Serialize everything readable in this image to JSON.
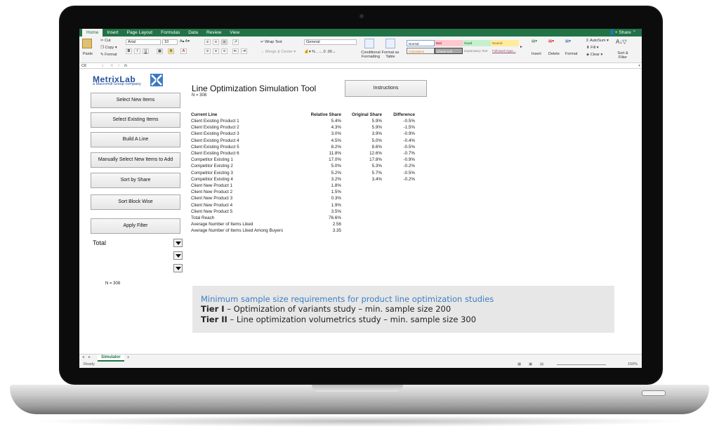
{
  "ribbon": {
    "tabs": [
      "Home",
      "Insert",
      "Page Layout",
      "Formulas",
      "Data",
      "Review",
      "View"
    ],
    "share_label": "Share",
    "paste": "Paste",
    "cut": "Cut",
    "copy": "Copy",
    "format": "Format",
    "font_name": "Arial",
    "font_size": "10",
    "bold": "B",
    "italic": "I",
    "underline": "U",
    "wrap_text": "Wrap Text",
    "merge_center": "Merge & Center",
    "number_format": "General",
    "conditional_formatting": "Conditional Formatting",
    "format_as_table": "Format as Table",
    "styles": [
      "Normal",
      "Bad",
      "Good",
      "Neutral",
      "Calculation",
      "Check Cell",
      "Explanatory Text",
      "Followed Hype..."
    ],
    "insert": "Insert",
    "delete": "Delete",
    "format_cells": "Format",
    "autosum": "AutoSum",
    "fill": "Fill",
    "clear": "Clear",
    "sort_filter": "Sort & Filter"
  },
  "formula_bar": {
    "cell_ref": "C6",
    "fx": "fx"
  },
  "sheet": {
    "logo_text": "MetrixLab",
    "logo_sub": "a Macromill Group company",
    "buttons": {
      "select_new": "Select New Items",
      "select_existing": "Select Existing Items",
      "build_line": "Build A Line",
      "manual_select": "Manually Select New Items to Add",
      "sort_share": "Sort by Share",
      "sort_block": "Sort Block Wise",
      "apply_filter": "Apply Filter",
      "instructions": "Instructions"
    },
    "title": "Line Optimization Simulation Tool",
    "n_top": "N = 308",
    "n_left": "N = 308",
    "filter_label": "Total",
    "table": {
      "headers": [
        "Current Line",
        "Relative Share",
        "Original Share",
        "Difference"
      ],
      "rows": [
        [
          "Client Existing Product 1",
          "5.4%",
          "5.9%",
          "-0.5%"
        ],
        [
          "Client Existing Product 2",
          "4.3%",
          "5.9%",
          "-1.5%"
        ],
        [
          "Client Existing Product 3",
          "3.0%",
          "3.9%",
          "-0.9%"
        ],
        [
          "Client Existing Product 4",
          "4.5%",
          "5.0%",
          "-0.4%"
        ],
        [
          "Client Existing Product 5",
          "8.2%",
          "8.6%",
          "-0.5%"
        ],
        [
          "Client Existing Product 6",
          "11.8%",
          "12.6%",
          "-0.7%"
        ],
        [
          "Competitor Existing 1",
          "17.0%",
          "17.8%",
          "-0.9%"
        ],
        [
          "Competitor Existing 2",
          "5.0%",
          "5.3%",
          "-0.2%"
        ],
        [
          "Competitor Existing 3",
          "5.2%",
          "5.7%",
          "-0.5%"
        ],
        [
          "Competitor Existing 4",
          "3.2%",
          "3.4%",
          "-0.2%"
        ],
        [
          "Client New Product 1",
          "1.8%",
          "",
          ""
        ],
        [
          "Client New Product 2",
          "1.5%",
          "",
          ""
        ],
        [
          "Client New Product 3",
          "0.3%",
          "",
          ""
        ],
        [
          "Client New Product 4",
          "1.9%",
          "",
          ""
        ],
        [
          "Client New Product 5",
          "3.5%",
          "",
          ""
        ],
        [
          "Total Reach",
          "76.6%",
          "",
          ""
        ],
        [
          "Average Number of Items Liked",
          "2.56",
          "",
          ""
        ],
        [
          "Average Number of Items Liked Among Buyers",
          "3.35",
          "",
          ""
        ]
      ]
    },
    "note": {
      "title": "Minimum sample size requirements for product line optimization studies",
      "tier1_label": "Tier I",
      "tier1_text": " – Optimization of variants study – min. sample size 200",
      "tier2_label": "Tier II",
      "tier2_text": " – Line optimization volumetrics study – min. sample size 300"
    }
  },
  "sheet_tabs": {
    "active": "Simulator",
    "add": "+"
  },
  "status": {
    "ready": "Ready",
    "zoom": "150%"
  }
}
